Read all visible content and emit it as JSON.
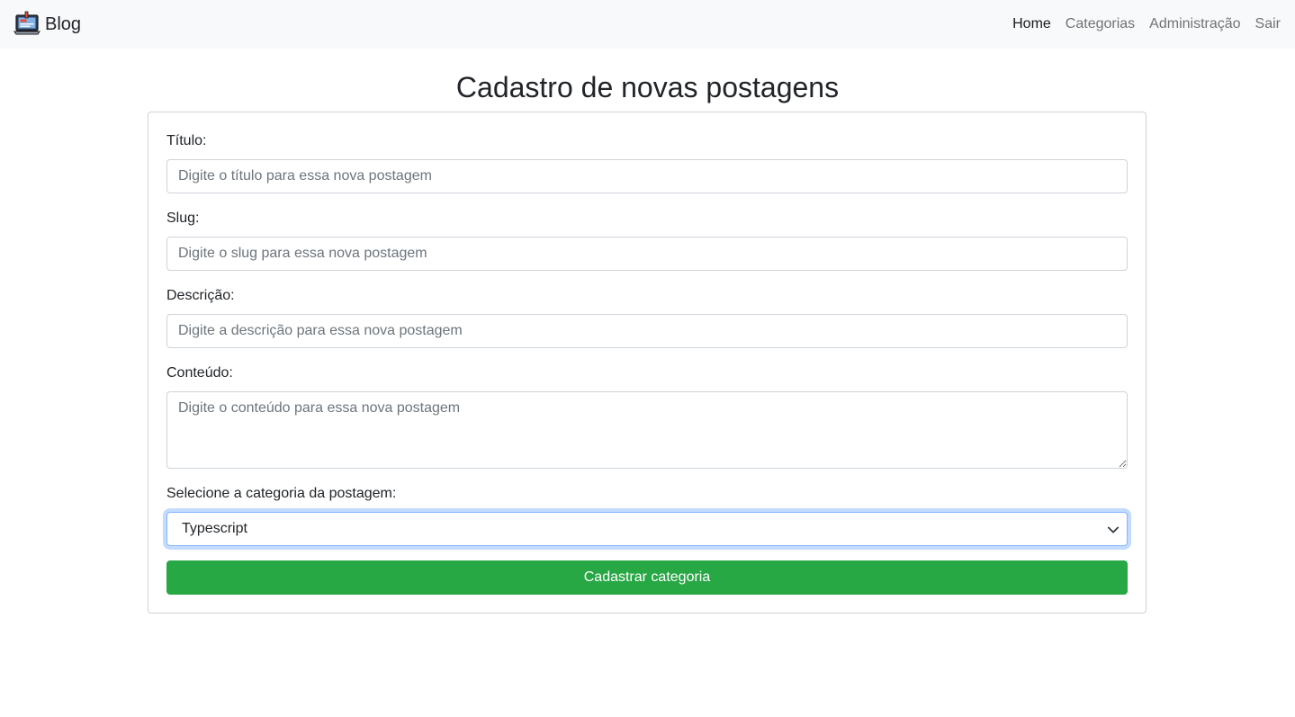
{
  "navbar": {
    "brand": "Blog",
    "brand_icon": "laptop-blog-icon",
    "links": [
      {
        "label": "Home",
        "active": true
      },
      {
        "label": "Categorias",
        "active": false
      },
      {
        "label": "Administração",
        "active": false
      },
      {
        "label": "Sair",
        "active": false
      }
    ]
  },
  "page": {
    "title": "Cadastro de novas postagens"
  },
  "form": {
    "titulo": {
      "label": "Título:",
      "placeholder": "Digite o título para essa nova postagem",
      "value": ""
    },
    "slug": {
      "label": "Slug:",
      "placeholder": "Digite o slug para essa nova postagem",
      "value": ""
    },
    "descricao": {
      "label": "Descrição:",
      "placeholder": "Digite a descrição para essa nova postagem",
      "value": ""
    },
    "conteudo": {
      "label": "Conteúdo:",
      "placeholder": "Digite o conteúdo para essa nova postagem",
      "value": ""
    },
    "categoria": {
      "label": "Selecione a categoria da postagem:",
      "selected": "Typescript"
    },
    "submit_label": "Cadastrar categoria"
  },
  "colors": {
    "navbar_bg": "#f8f9fa",
    "submit_bg": "#28a745",
    "focus_border": "#86b7fe"
  }
}
